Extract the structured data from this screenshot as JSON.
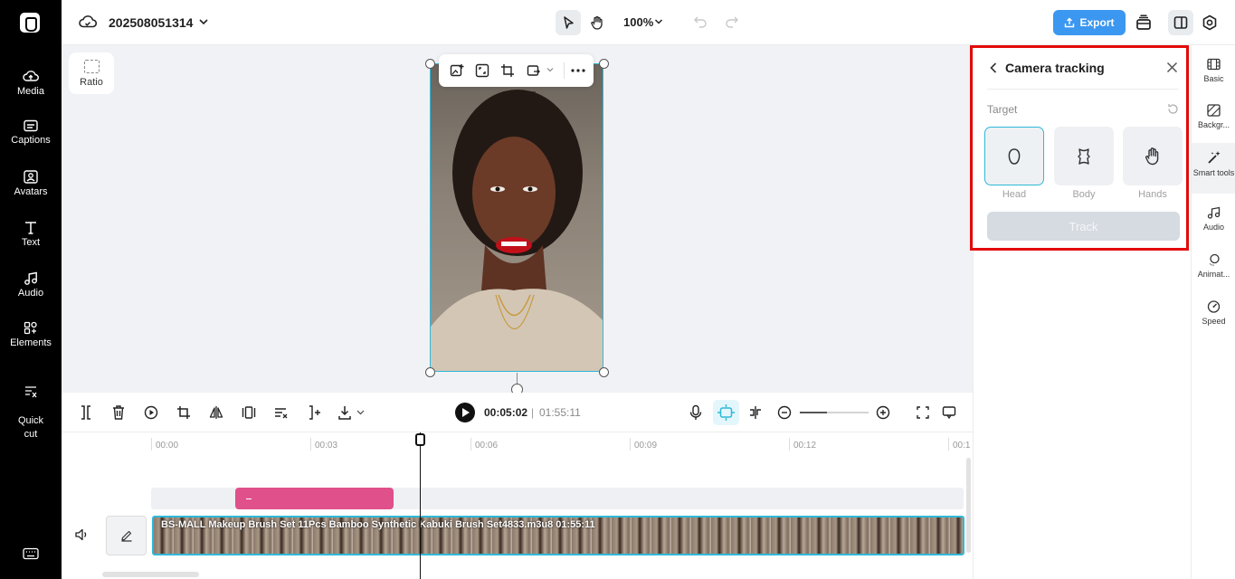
{
  "app": {
    "project_name": "202508051314",
    "zoom_level": "100%",
    "export_label": "Export"
  },
  "left_nav": {
    "items": [
      {
        "label": "Media",
        "icon": "cloud-upload-icon"
      },
      {
        "label": "Captions",
        "icon": "captions-icon"
      },
      {
        "label": "Avatars",
        "icon": "avatar-icon"
      },
      {
        "label": "Text",
        "icon": "text-icon"
      },
      {
        "label": "Audio",
        "icon": "music-note-icon"
      },
      {
        "label": "Elements",
        "icon": "elements-icon"
      },
      {
        "label": "Quick\ncut",
        "icon": "quick-cut-icon"
      }
    ]
  },
  "canvas": {
    "ratio_label": "Ratio"
  },
  "camera_tracking": {
    "title": "Camera tracking",
    "target_label": "Target",
    "options": [
      {
        "label": "Head",
        "selected": true
      },
      {
        "label": "Body",
        "selected": false
      },
      {
        "label": "Hands",
        "selected": false
      }
    ],
    "track_button": "Track"
  },
  "right_tabs": {
    "items": [
      {
        "label": "Basic"
      },
      {
        "label": "Backgr..."
      },
      {
        "label": "Smart tools",
        "active": true
      },
      {
        "label": "Audio"
      },
      {
        "label": "Animat..."
      },
      {
        "label": "Speed"
      }
    ]
  },
  "playback": {
    "current_time": "00:05:02",
    "separator": "|",
    "total_time": "01:55:11"
  },
  "timeline": {
    "ticks": [
      "00:00",
      "00:03",
      "00:06",
      "00:09",
      "00:12",
      "00:1"
    ],
    "clip_label": "BS-MALL Makeup Brush Set 11Pcs Bamboo Synthetic Kabuki Brush Set4833.m3u8   01:55:11"
  },
  "colors": {
    "accent": "#2fb8d8",
    "export": "#3b97f0",
    "highlight": "#e30b0b",
    "pink_clip": "#e0508a"
  }
}
